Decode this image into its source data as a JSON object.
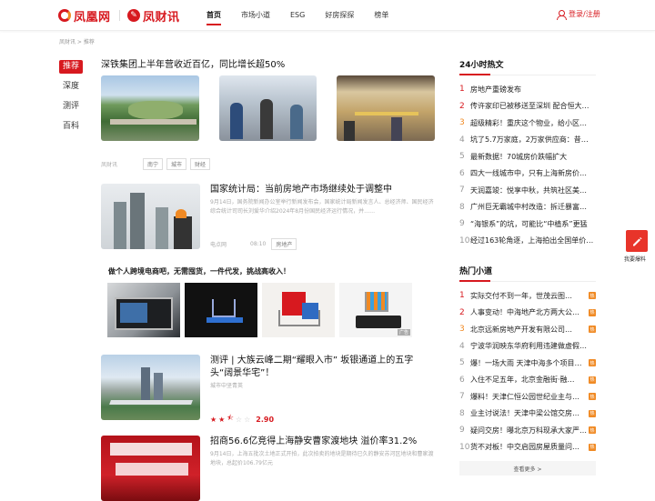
{
  "header": {
    "logo1": "凤凰网",
    "logo2": "凤财讯",
    "nav": [
      "首页",
      "市场小道",
      "ESG",
      "好房探探",
      "榜单"
    ],
    "login": "登录/注册"
  },
  "breadcrumb": "凤财讯 > 推荐",
  "sidebar": [
    "推荐",
    "深度",
    "测评",
    "百科"
  ],
  "feed": {
    "item1": {
      "title": "深铁集团上半年营收近百亿，同比增长超50%",
      "source": "凤财讯",
      "tags": [
        "南宁",
        "城市",
        "财经"
      ]
    },
    "item2": {
      "title": "国家统计局：当前房地产市场继续处于调整中",
      "desc": "9月14日，国务院新闻办公室举行新闻发布会，国家统计局新闻发言人、总经济师、国民经济综合统计司司长刘爱华介绍2024年8月份国民经济运行情况，并……",
      "source": "电点网",
      "time": "08:10",
      "tag": "房地产"
    },
    "ad": {
      "title": "做个人跨境电商吧，无需囤货，一件代发，挑战高收入！",
      "badge": "广告"
    },
    "item3": {
      "title": "测评 | 大族云峰二期“耀眼入市” 坂银通道上的五字头“阔景华宅”！",
      "sub": "城市中坚青英",
      "rating": "2.90"
    },
    "item4": {
      "title": "招商56.6亿竞得上海静安曹家渡地块 溢价率31.2%",
      "desc": "9月14日，上海五批次土地正式开拍，此次拍卖的地块是期待已久的静安苏河区地块和曹家渡地块，总起价106.79亿元"
    }
  },
  "hot24": {
    "title": "24小时热文",
    "items": [
      "房地产重磅发布",
      "传许家印已被移送至深圳 配合恒大…",
      "超级精彩！重庆这个物业，给小区…",
      "坑了5.7万家庭，2万家供应商：昔…",
      "最新数据！70城房价跌幅扩大",
      "四大一线城市中，只有上海新房价…",
      "天润嘉竣：悦享中秋，共筑社区美…",
      "广州巨无霸城中村改造：拆迁暴富…",
      "“海银系”的坑，可能比“中植系”更猛",
      "经过163轮角逐，上海拍出全国单价…"
    ]
  },
  "hotlane": {
    "title": "热门小道",
    "items": [
      "实际交付不到一年，世茂云图…",
      "人事变动！中海地产北方两大公…",
      "北京远新房地产开发有限公司…",
      "宁波华润映东华府利用违建做虚假…",
      "爆！一场大雨 天津中海多个项目…",
      "入住不足五年，北京金融街·融…",
      "爆料！天津仁恒公园世纪业主与…",
      "业主讨说法！天津中梁公馆交房…",
      "疑问交房！曝北京万科现承大家严…",
      "货不对板！中交启园房屋质量问…"
    ],
    "badges": [
      true,
      true,
      true,
      false,
      true,
      true,
      true,
      true,
      true,
      true
    ],
    "badge_label": "热",
    "more": "查看更多 >"
  },
  "float": {
    "label": "我要爆料"
  },
  "colors": {
    "accent": "#d7191f",
    "orange": "#f08a24"
  }
}
